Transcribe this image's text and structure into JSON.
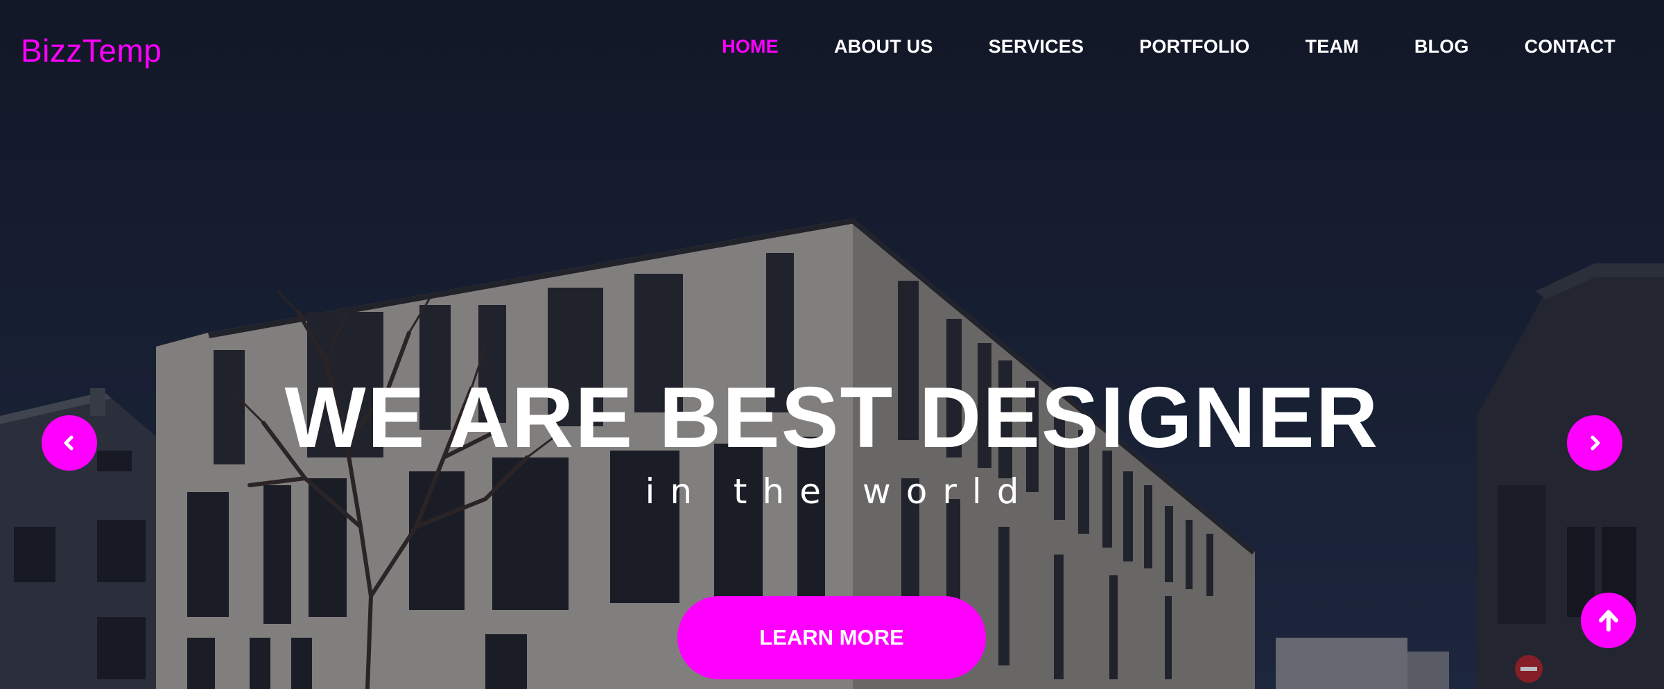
{
  "brand": {
    "name": "BizzTemp"
  },
  "nav": {
    "items": [
      {
        "label": "HOME",
        "active": true
      },
      {
        "label": "ABOUT US",
        "active": false
      },
      {
        "label": "SERVICES",
        "active": false
      },
      {
        "label": "PORTFOLIO",
        "active": false
      },
      {
        "label": "TEAM",
        "active": false
      },
      {
        "label": "BLOG",
        "active": false
      },
      {
        "label": "CONTACT",
        "active": false
      }
    ]
  },
  "hero": {
    "title": "WE ARE BEST DESIGNER",
    "subtitle": "in the world",
    "cta_label": "LEARN MORE"
  },
  "controls": {
    "prev_icon": "chevron-left-icon",
    "next_icon": "chevron-right-icon",
    "back_to_top_icon": "arrow-up-icon"
  },
  "colors": {
    "accent": "#ff00ff",
    "nav_text": "#ffffff",
    "background": "#141a2a"
  }
}
